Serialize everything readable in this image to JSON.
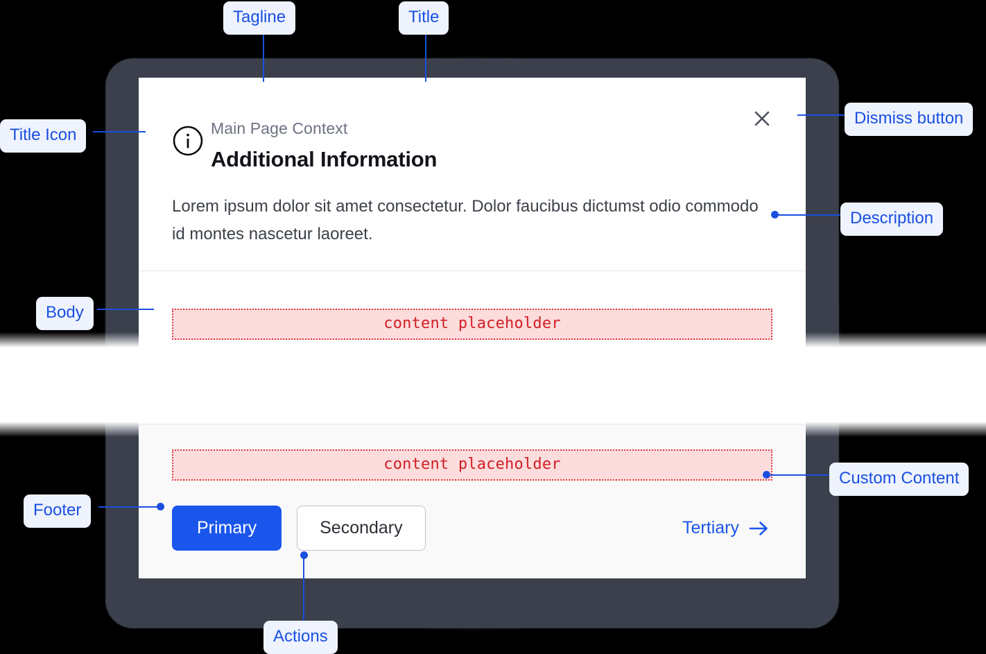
{
  "page": {
    "background_color": "#000000",
    "accent_color": "#1a4fe0"
  },
  "dialog": {
    "tagline": "Main Page Context",
    "title": "Additional Information",
    "title_icon": "info-circle-icon",
    "dismiss_icon": "close-icon",
    "description": "Lorem ipsum dolor sit amet consectetur. Dolor faucibus dictumst odio commodo id montes nascetur laoreet.",
    "body": {
      "placeholder_label": "content placeholder"
    },
    "footer": {
      "custom_content_placeholder": "content placeholder",
      "actions": {
        "primary_label": "Primary",
        "secondary_label": "Secondary",
        "tertiary_label": "Tertiary",
        "tertiary_icon": "arrow-right-icon"
      }
    },
    "colors": {
      "primary_button": "#1a56ec",
      "surface": "#ffffff",
      "footer_surface": "#f9f9fa",
      "divider": "#e3e5e9",
      "placeholder_border": "#e0393e",
      "placeholder_fill": "#fcdcdc",
      "placeholder_text": "#d01f26"
    }
  },
  "annotations": {
    "tagline": "Tagline",
    "title": "Title",
    "dismiss_button": "Dismiss button",
    "title_icon": "Title Icon",
    "description": "Description",
    "body": "Body",
    "custom_content": "Custom Content",
    "footer": "Footer",
    "actions": "Actions"
  }
}
